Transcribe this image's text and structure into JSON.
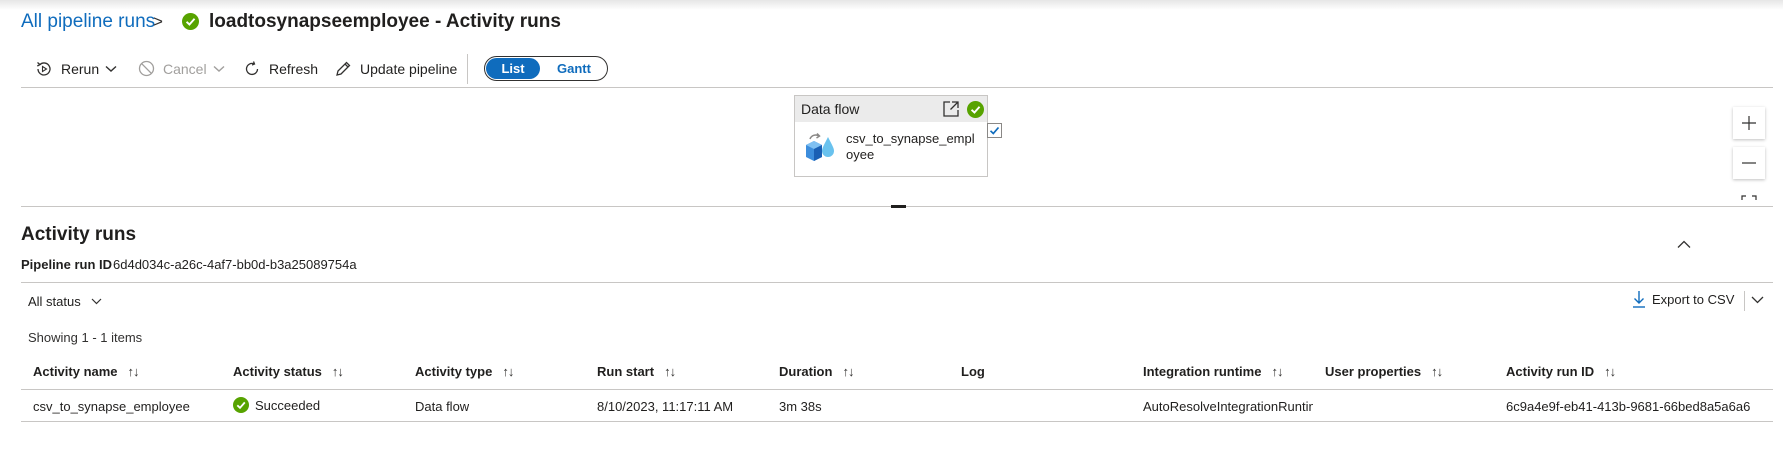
{
  "breadcrumb": {
    "parent": "All pipeline runs",
    "separator": ">",
    "title": "loadtosynapseemployee - Activity runs"
  },
  "toolbar": {
    "rerun": "Rerun",
    "cancel": "Cancel",
    "refresh": "Refresh",
    "update_pipeline": "Update pipeline",
    "view_list": "List",
    "view_gantt": "Gantt"
  },
  "canvas": {
    "node_type": "Data flow",
    "node_name": "csv_to_synapse_employee"
  },
  "activity_runs": {
    "title": "Activity runs",
    "pipeline_run_id_label": "Pipeline run ID",
    "pipeline_run_id": "6d4d034c-a26c-4af7-bb0d-b3a25089754a",
    "status_filter": "All status",
    "export": "Export to CSV",
    "showing": "Showing 1 - 1 items",
    "columns": [
      "Activity name",
      "Activity status",
      "Activity type",
      "Run start",
      "Duration",
      "Log",
      "Integration runtime",
      "User properties",
      "Activity run ID"
    ],
    "rows": [
      {
        "activity_name": "csv_to_synapse_employee",
        "activity_status": "Succeeded",
        "activity_type": "Data flow",
        "run_start": "8/10/2023, 11:17:11 AM",
        "duration": "3m 38s",
        "log": "",
        "integration_runtime": "AutoResolveIntegrationRuntime",
        "user_properties": "",
        "activity_run_id": "6c9a4e9f-eb41-413b-9681-66bed8a5a6a6"
      }
    ]
  },
  "colors": {
    "accent": "#0f6cbd",
    "success": "#57a300"
  }
}
